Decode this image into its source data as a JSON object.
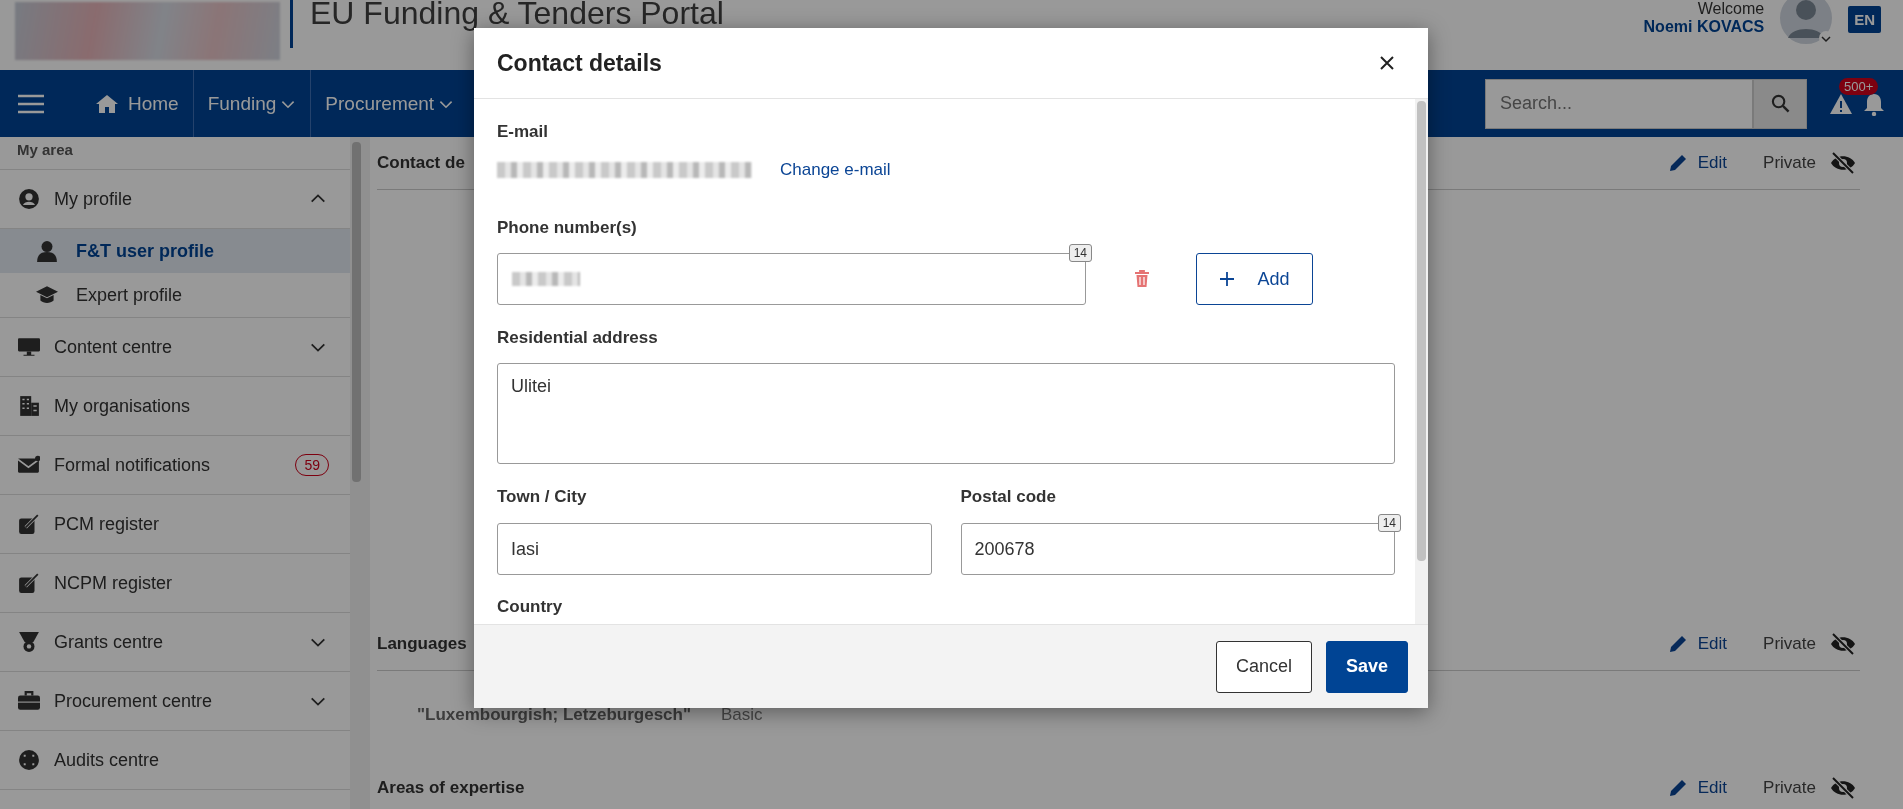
{
  "header": {
    "title": "EU Funding & Tenders Portal",
    "welcome": "Welcome",
    "user_name": "Noemi KOVACS",
    "language": "EN"
  },
  "nav": {
    "items": [
      {
        "label": "Home",
        "kind": "home"
      },
      {
        "label": "Funding",
        "kind": "dropdown"
      },
      {
        "label": "Procurement",
        "kind": "dropdown"
      }
    ],
    "search": {
      "placeholder": "Search..."
    },
    "notification_count": "500+"
  },
  "sidebar": {
    "heading": "My area",
    "items": [
      {
        "label": "My profile",
        "expanded": true,
        "children": [
          {
            "label": "F&T user profile",
            "selected": true
          },
          {
            "label": "Expert profile",
            "selected": false
          }
        ]
      },
      {
        "label": "Content centre",
        "expanded": false
      },
      {
        "label": "My organisations"
      },
      {
        "label": "Formal notifications",
        "badge": "59"
      },
      {
        "label": "PCM register"
      },
      {
        "label": "NCPM register"
      },
      {
        "label": "Grants centre",
        "expanded": false
      },
      {
        "label": "Procurement centre",
        "expanded": false
      },
      {
        "label": "Audits centre"
      }
    ]
  },
  "sections": [
    {
      "title": "Contact de",
      "edit": "Edit",
      "visibility": "Private"
    },
    {
      "title": "Languages",
      "edit": "Edit",
      "visibility": "Private",
      "rows": [
        {
          "language": "\"Luxembourgish; Letzeburgesch\"",
          "proficiency": "Basic"
        }
      ]
    },
    {
      "title": "Areas of expertise",
      "edit": "Edit",
      "visibility": "Private"
    }
  ],
  "dialog": {
    "title": "Contact details",
    "email": {
      "label": "E-mail",
      "link": "Change e-mail"
    },
    "phone": {
      "label": "Phone number(s)",
      "counter": "14",
      "add_button": "Add"
    },
    "address": {
      "label": "Residential address",
      "value": "Ulitei"
    },
    "town": {
      "label": "Town / City",
      "value": "Iasi"
    },
    "postal_code": {
      "label": "Postal code",
      "value": "200678",
      "counter": "14"
    },
    "country": {
      "label": "Country"
    },
    "buttons": [
      {
        "label": "Cancel",
        "kind": "secondary"
      },
      {
        "label": "Save",
        "kind": "primary"
      }
    ]
  }
}
